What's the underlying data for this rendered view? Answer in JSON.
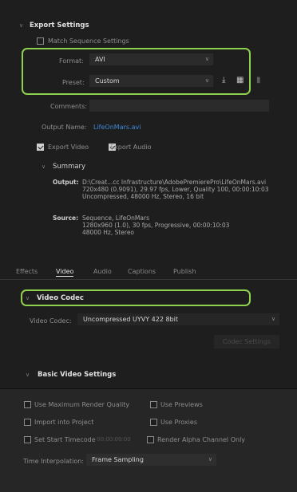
{
  "export_settings": {
    "header": "Export Settings",
    "match_sequence": "Match Sequence Settings",
    "format_label": "Format:",
    "format_value": "AVI",
    "preset_label": "Preset:",
    "preset_value": "Custom",
    "comments_label": "Comments:",
    "output_name_label": "Output Name:",
    "output_name_value": "LifeOnMars.avi",
    "export_video": "Export Video",
    "export_audio": "Export Audio"
  },
  "summary": {
    "header": "Summary",
    "output_key": "Output:",
    "output_lines": [
      "D:\\Creat...cc Infrastructure\\AdobePremierePro\\LifeOnMars.avi",
      "720x480 (0.9091), 29.97 fps, Lower, Quality 100, 00:00:10:03",
      "Uncompressed, 48000 Hz, Stereo, 16 bit"
    ],
    "source_key": "Source:",
    "source_lines": [
      "Sequence, LifeOnMars",
      "1280x960 (1.0), 30 fps, Progressive, 00:00:10:03",
      "48000 Hz, Stereo"
    ]
  },
  "tabs": [
    "Effects",
    "Video",
    "Audio",
    "Captions",
    "Publish"
  ],
  "video_codec": {
    "header": "Video Codec",
    "label": "Video Codec:",
    "value": "Uncompressed UYVY 422 8bit",
    "codec_setup_button": "Codec Settings"
  },
  "basic_video": {
    "header": "Basic Video Settings"
  },
  "bottom": {
    "use_max_render": "Use Maximum Render Quality",
    "use_previews": "Use Previews",
    "import_into_project": "Import into Project",
    "use_proxies": "Use Proxies",
    "set_start_timecode": "Set Start Timecode",
    "timecode_value": "00:00:00:00",
    "render_alpha": "Render Alpha Channel Only",
    "time_interp_label": "Time Interpolation:",
    "time_interp_value": "Frame Sampling"
  },
  "colors": {
    "highlight_green": "#8fd14f",
    "link_blue": "#3c8ad8"
  }
}
